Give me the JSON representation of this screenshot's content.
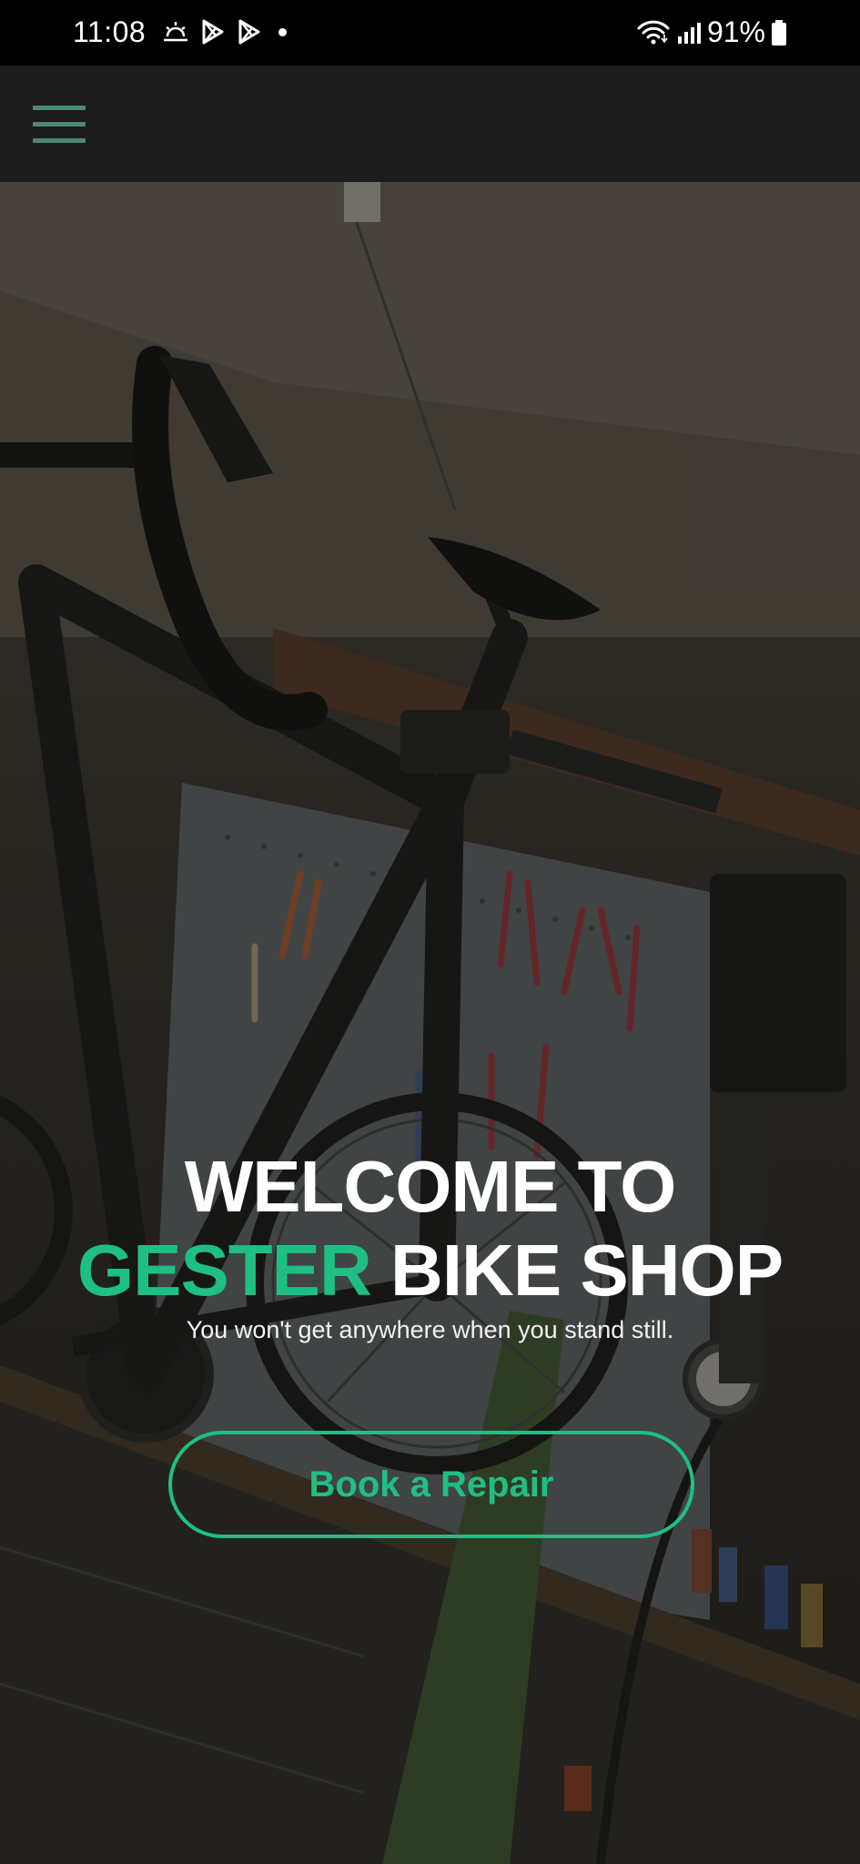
{
  "status_bar": {
    "time": "11:08",
    "battery": "91%",
    "icons_left": [
      "weather-sunrise-icon",
      "play-store-icon",
      "play-store-icon",
      "notification-dot-icon"
    ],
    "icons_right": [
      "wifi-icon",
      "signal-icon",
      "battery-icon"
    ]
  },
  "navbar": {
    "menu_icon": "hamburger-menu-icon",
    "accent_color": "#4b8a6c",
    "background": "#1c1c1c"
  },
  "hero": {
    "title_line1": "WELCOME TO",
    "title_accent": "GESTER",
    "title_rest": "BIKE SHOP",
    "subtitle": "You won't get anywhere when you stand still.",
    "cta_label": "Book a Repair",
    "accent_color": "#1fbf83"
  }
}
